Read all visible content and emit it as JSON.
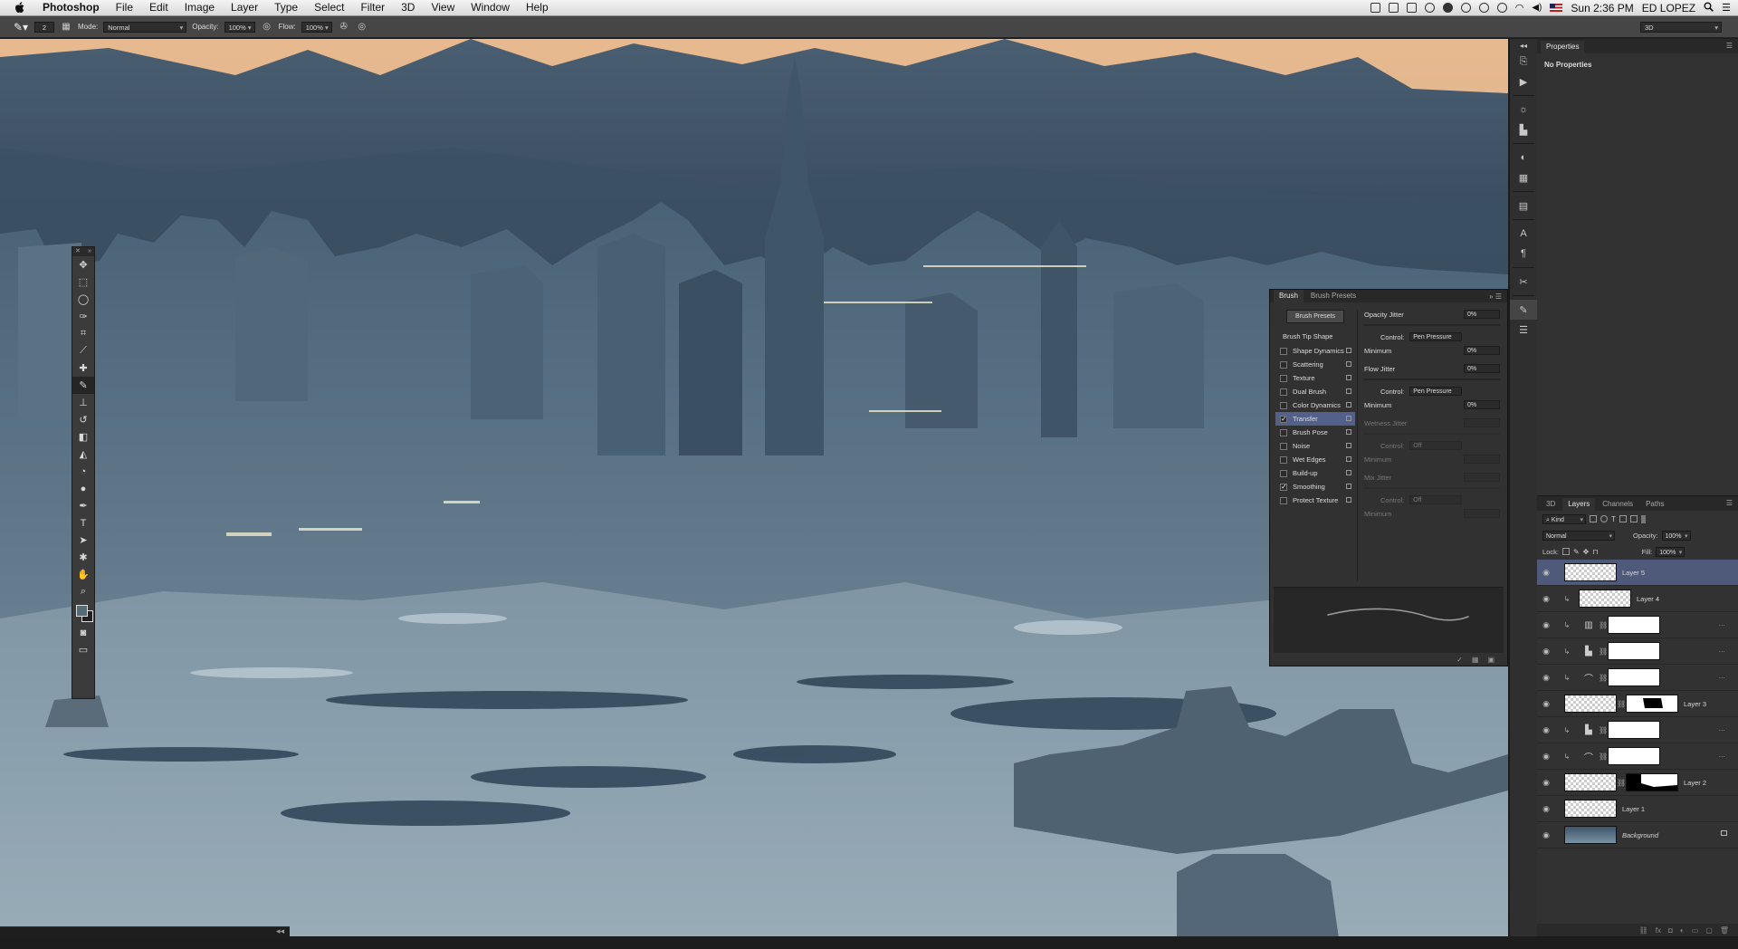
{
  "menubar": {
    "app_name": "Photoshop",
    "menus": [
      "File",
      "Edit",
      "Image",
      "Layer",
      "Type",
      "Select",
      "Filter",
      "3D",
      "View",
      "Window",
      "Help"
    ],
    "clock": "Sun 2:36 PM",
    "user": "ED LOPEZ"
  },
  "options_bar": {
    "brush_size": "2",
    "mode_label": "Mode:",
    "mode_value": "Normal",
    "opacity_label": "Opacity:",
    "opacity_value": "100%",
    "flow_label": "Flow:",
    "flow_value": "100%",
    "workspace": "3D"
  },
  "properties": {
    "tab": "Properties",
    "empty_text": "No Properties"
  },
  "brush_panel": {
    "tabs": [
      "Brush",
      "Brush Presets"
    ],
    "presets_button": "Brush Presets",
    "tip_shape": "Brush Tip Shape",
    "options": [
      {
        "label": "Shape Dynamics",
        "checked": false,
        "active": false
      },
      {
        "label": "Scattering",
        "checked": false,
        "active": false
      },
      {
        "label": "Texture",
        "checked": false,
        "active": false
      },
      {
        "label": "Dual Brush",
        "checked": false,
        "active": false
      },
      {
        "label": "Color Dynamics",
        "checked": false,
        "active": false
      },
      {
        "label": "Transfer",
        "checked": true,
        "active": true
      },
      {
        "label": "Brush Pose",
        "checked": false,
        "active": false
      },
      {
        "label": "Noise",
        "checked": false,
        "active": false
      },
      {
        "label": "Wet Edges",
        "checked": false,
        "active": false
      },
      {
        "label": "Build-up",
        "checked": false,
        "active": false
      },
      {
        "label": "Smoothing",
        "checked": true,
        "active": false
      },
      {
        "label": "Protect Texture",
        "checked": false,
        "active": false
      }
    ],
    "opacity_jitter": "Opacity Jitter",
    "opacity_jitter_value": "0%",
    "control_label": "Control:",
    "control_pen": "Pen Pressure",
    "control_off": "Off",
    "minimum_label": "Minimum",
    "minimum_value": "0%",
    "flow_jitter": "Flow Jitter",
    "flow_jitter_value": "0%",
    "wetness_jitter": "Wetness Jitter",
    "mix_jitter": "Mix Jitter"
  },
  "layers_panel": {
    "tabs": [
      "3D",
      "Layers",
      "Channels",
      "Paths"
    ],
    "active_tab": "Layers",
    "kind_label": "Kind",
    "blend_mode": "Normal",
    "opacity_label": "Opacity:",
    "opacity_value": "100%",
    "lock_label": "Lock:",
    "fill_label": "Fill:",
    "fill_value": "100%",
    "layers": [
      {
        "name": "Layer 5",
        "type": "pixel",
        "selected": true,
        "clipped": false
      },
      {
        "name": "Layer 4",
        "type": "pixel",
        "selected": false,
        "clipped": true
      },
      {
        "name": "",
        "type": "adjustment",
        "icon": "levels-icon",
        "clipped": true
      },
      {
        "name": "",
        "type": "adjustment",
        "icon": "histogram-icon",
        "clipped": true
      },
      {
        "name": "",
        "type": "adjustment",
        "icon": "curves-icon",
        "clipped": true
      },
      {
        "name": "Layer 3",
        "type": "masked",
        "selected": false,
        "clipped": false
      },
      {
        "name": "",
        "type": "adjustment",
        "icon": "histogram-icon",
        "clipped": true
      },
      {
        "name": "",
        "type": "adjustment",
        "icon": "curves-icon",
        "clipped": true
      },
      {
        "name": "Layer 2",
        "type": "masked",
        "selected": false,
        "clipped": false
      },
      {
        "name": "Layer 1",
        "type": "pixel",
        "selected": false,
        "clipped": false
      },
      {
        "name": "Background",
        "type": "background",
        "selected": false,
        "clipped": false
      }
    ]
  }
}
